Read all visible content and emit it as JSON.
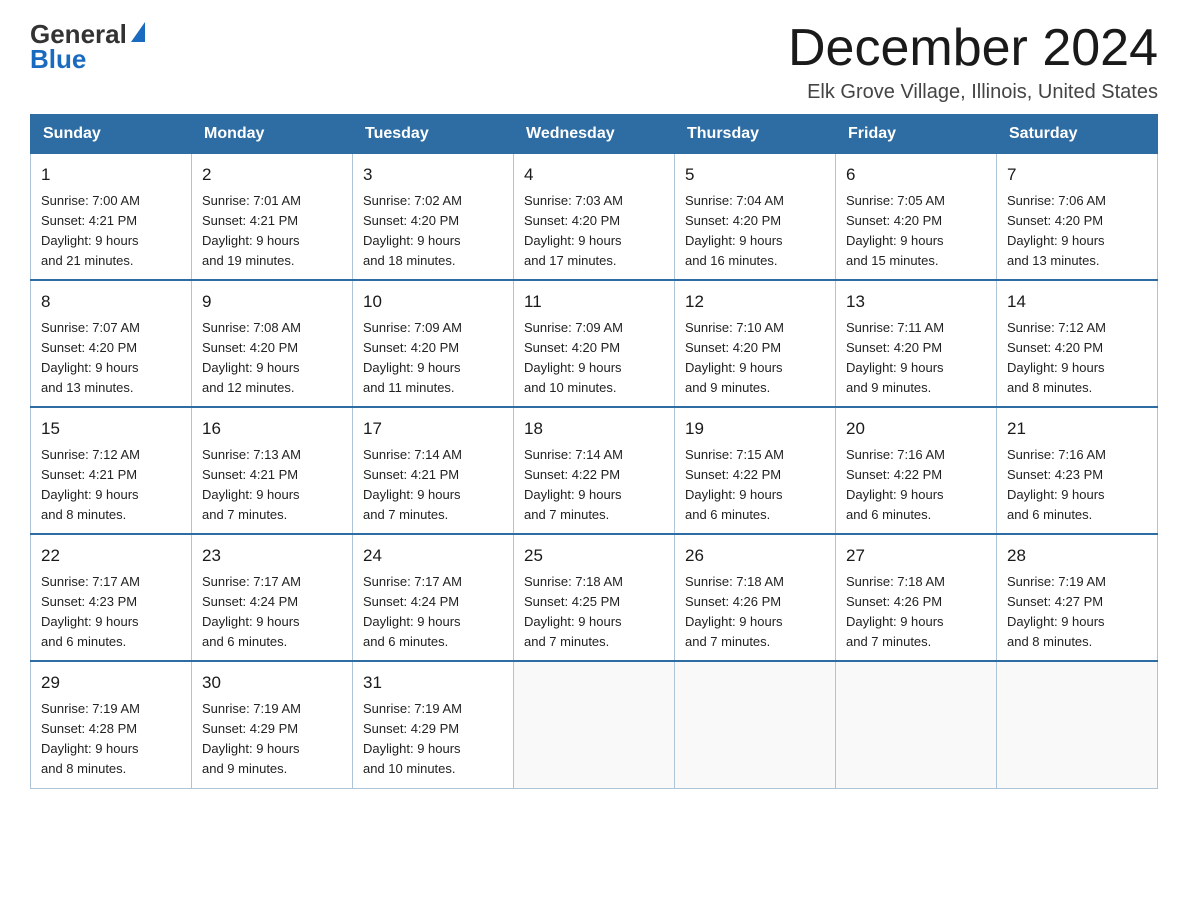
{
  "header": {
    "logo": {
      "text_general": "General",
      "text_blue": "Blue"
    },
    "title": "December 2024",
    "location": "Elk Grove Village, Illinois, United States"
  },
  "weekdays": [
    "Sunday",
    "Monday",
    "Tuesday",
    "Wednesday",
    "Thursday",
    "Friday",
    "Saturday"
  ],
  "weeks": [
    [
      {
        "day": "1",
        "sunrise": "7:00 AM",
        "sunset": "4:21 PM",
        "daylight": "9 hours and 21 minutes."
      },
      {
        "day": "2",
        "sunrise": "7:01 AM",
        "sunset": "4:21 PM",
        "daylight": "9 hours and 19 minutes."
      },
      {
        "day": "3",
        "sunrise": "7:02 AM",
        "sunset": "4:20 PM",
        "daylight": "9 hours and 18 minutes."
      },
      {
        "day": "4",
        "sunrise": "7:03 AM",
        "sunset": "4:20 PM",
        "daylight": "9 hours and 17 minutes."
      },
      {
        "day": "5",
        "sunrise": "7:04 AM",
        "sunset": "4:20 PM",
        "daylight": "9 hours and 16 minutes."
      },
      {
        "day": "6",
        "sunrise": "7:05 AM",
        "sunset": "4:20 PM",
        "daylight": "9 hours and 15 minutes."
      },
      {
        "day": "7",
        "sunrise": "7:06 AM",
        "sunset": "4:20 PM",
        "daylight": "9 hours and 13 minutes."
      }
    ],
    [
      {
        "day": "8",
        "sunrise": "7:07 AM",
        "sunset": "4:20 PM",
        "daylight": "9 hours and 13 minutes."
      },
      {
        "day": "9",
        "sunrise": "7:08 AM",
        "sunset": "4:20 PM",
        "daylight": "9 hours and 12 minutes."
      },
      {
        "day": "10",
        "sunrise": "7:09 AM",
        "sunset": "4:20 PM",
        "daylight": "9 hours and 11 minutes."
      },
      {
        "day": "11",
        "sunrise": "7:09 AM",
        "sunset": "4:20 PM",
        "daylight": "9 hours and 10 minutes."
      },
      {
        "day": "12",
        "sunrise": "7:10 AM",
        "sunset": "4:20 PM",
        "daylight": "9 hours and 9 minutes."
      },
      {
        "day": "13",
        "sunrise": "7:11 AM",
        "sunset": "4:20 PM",
        "daylight": "9 hours and 9 minutes."
      },
      {
        "day": "14",
        "sunrise": "7:12 AM",
        "sunset": "4:20 PM",
        "daylight": "9 hours and 8 minutes."
      }
    ],
    [
      {
        "day": "15",
        "sunrise": "7:12 AM",
        "sunset": "4:21 PM",
        "daylight": "9 hours and 8 minutes."
      },
      {
        "day": "16",
        "sunrise": "7:13 AM",
        "sunset": "4:21 PM",
        "daylight": "9 hours and 7 minutes."
      },
      {
        "day": "17",
        "sunrise": "7:14 AM",
        "sunset": "4:21 PM",
        "daylight": "9 hours and 7 minutes."
      },
      {
        "day": "18",
        "sunrise": "7:14 AM",
        "sunset": "4:22 PM",
        "daylight": "9 hours and 7 minutes."
      },
      {
        "day": "19",
        "sunrise": "7:15 AM",
        "sunset": "4:22 PM",
        "daylight": "9 hours and 6 minutes."
      },
      {
        "day": "20",
        "sunrise": "7:16 AM",
        "sunset": "4:22 PM",
        "daylight": "9 hours and 6 minutes."
      },
      {
        "day": "21",
        "sunrise": "7:16 AM",
        "sunset": "4:23 PM",
        "daylight": "9 hours and 6 minutes."
      }
    ],
    [
      {
        "day": "22",
        "sunrise": "7:17 AM",
        "sunset": "4:23 PM",
        "daylight": "9 hours and 6 minutes."
      },
      {
        "day": "23",
        "sunrise": "7:17 AM",
        "sunset": "4:24 PM",
        "daylight": "9 hours and 6 minutes."
      },
      {
        "day": "24",
        "sunrise": "7:17 AM",
        "sunset": "4:24 PM",
        "daylight": "9 hours and 6 minutes."
      },
      {
        "day": "25",
        "sunrise": "7:18 AM",
        "sunset": "4:25 PM",
        "daylight": "9 hours and 7 minutes."
      },
      {
        "day": "26",
        "sunrise": "7:18 AM",
        "sunset": "4:26 PM",
        "daylight": "9 hours and 7 minutes."
      },
      {
        "day": "27",
        "sunrise": "7:18 AM",
        "sunset": "4:26 PM",
        "daylight": "9 hours and 7 minutes."
      },
      {
        "day": "28",
        "sunrise": "7:19 AM",
        "sunset": "4:27 PM",
        "daylight": "9 hours and 8 minutes."
      }
    ],
    [
      {
        "day": "29",
        "sunrise": "7:19 AM",
        "sunset": "4:28 PM",
        "daylight": "9 hours and 8 minutes."
      },
      {
        "day": "30",
        "sunrise": "7:19 AM",
        "sunset": "4:29 PM",
        "daylight": "9 hours and 9 minutes."
      },
      {
        "day": "31",
        "sunrise": "7:19 AM",
        "sunset": "4:29 PM",
        "daylight": "9 hours and 10 minutes."
      },
      null,
      null,
      null,
      null
    ]
  ]
}
